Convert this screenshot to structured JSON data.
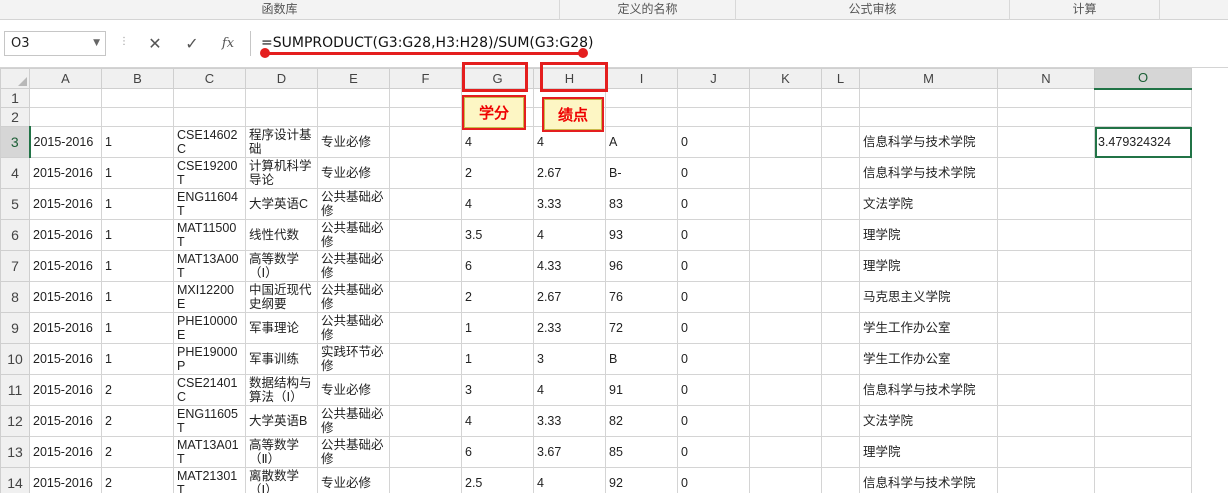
{
  "ribbon": {
    "groups": [
      "函数库",
      "定义的名称",
      "公式审核",
      "计算"
    ]
  },
  "formula_bar": {
    "name_box": "O3",
    "cancel_glyph": "✕",
    "enter_glyph": "✓",
    "fx_glyph": "fx",
    "formula": "=SUMPRODUCT(G3:G28,H3:H28)/SUM(G3:G28)"
  },
  "columns": [
    "A",
    "B",
    "C",
    "D",
    "E",
    "F",
    "G",
    "H",
    "I",
    "J",
    "K",
    "L",
    "M",
    "N",
    "O"
  ],
  "annotations": {
    "credit_label": "学分",
    "gpa_label": "绩点"
  },
  "rows": [
    {
      "num": "1",
      "cells": [
        "",
        "",
        "",
        "",
        "",
        "",
        "",
        "",
        "",
        "",
        "",
        "",
        "",
        "",
        ""
      ]
    },
    {
      "num": "2",
      "cells": [
        "",
        "",
        "",
        "",
        "",
        "",
        "",
        "",
        "",
        "",
        "",
        "",
        "",
        "",
        ""
      ]
    },
    {
      "num": "3",
      "cells": [
        "2015-2016",
        "1",
        "CSE14602C",
        "程序设计基础",
        "专业必修",
        "",
        "4",
        "4",
        "A",
        "0",
        "",
        "",
        "信息科学与技术学院",
        "",
        "3.479324324"
      ]
    },
    {
      "num": "4",
      "cells": [
        "2015-2016",
        "1",
        "CSE19200T",
        "计算机科学导论",
        "专业必修",
        "",
        "2",
        "2.67",
        "B-",
        "0",
        "",
        "",
        "信息科学与技术学院",
        "",
        ""
      ]
    },
    {
      "num": "5",
      "cells": [
        "2015-2016",
        "1",
        "ENG11604T",
        "大学英语C",
        "公共基础必修",
        "",
        "4",
        "3.33",
        "83",
        "0",
        "",
        "",
        "文法学院",
        "",
        ""
      ]
    },
    {
      "num": "6",
      "cells": [
        "2015-2016",
        "1",
        "MAT11500T",
        "线性代数",
        "公共基础必修",
        "",
        "3.5",
        "4",
        "93",
        "0",
        "",
        "",
        "理学院",
        "",
        ""
      ]
    },
    {
      "num": "7",
      "cells": [
        "2015-2016",
        "1",
        "MAT13A00T",
        "高等数学（Ⅰ）",
        "公共基础必修",
        "",
        "6",
        "4.33",
        "96",
        "0",
        "",
        "",
        "理学院",
        "",
        ""
      ]
    },
    {
      "num": "8",
      "cells": [
        "2015-2016",
        "1",
        "MXI12200E",
        "中国近现代史纲要",
        "公共基础必修",
        "",
        "2",
        "2.67",
        "76",
        "0",
        "",
        "",
        "马克思主义学院",
        "",
        ""
      ]
    },
    {
      "num": "9",
      "cells": [
        "2015-2016",
        "1",
        "PHE10000E",
        "军事理论",
        "公共基础必修",
        "",
        "1",
        "2.33",
        "72",
        "0",
        "",
        "",
        "学生工作办公室",
        "",
        ""
      ]
    },
    {
      "num": "10",
      "cells": [
        "2015-2016",
        "1",
        "PHE19000P",
        "军事训练",
        "实践环节必修",
        "",
        "1",
        "3",
        "B",
        "0",
        "",
        "",
        "学生工作办公室",
        "",
        ""
      ]
    },
    {
      "num": "11",
      "cells": [
        "2015-2016",
        "2",
        "CSE21401C",
        "数据结构与算法（Ⅰ）",
        "专业必修",
        "",
        "3",
        "4",
        "91",
        "0",
        "",
        "",
        "信息科学与技术学院",
        "",
        ""
      ]
    },
    {
      "num": "12",
      "cells": [
        "2015-2016",
        "2",
        "ENG11605T",
        "大学英语B",
        "公共基础必修",
        "",
        "4",
        "3.33",
        "82",
        "0",
        "",
        "",
        "文法学院",
        "",
        ""
      ]
    },
    {
      "num": "13",
      "cells": [
        "2015-2016",
        "2",
        "MAT13A01T",
        "高等数学（Ⅱ）",
        "公共基础必修",
        "",
        "6",
        "3.67",
        "85",
        "0",
        "",
        "",
        "理学院",
        "",
        ""
      ]
    },
    {
      "num": "14",
      "cells": [
        "2015-2016",
        "2",
        "MAT21301T",
        "离散数学（Ⅰ）",
        "专业必修",
        "",
        "2.5",
        "4",
        "92",
        "0",
        "",
        "",
        "信息科学与技术学院",
        "",
        ""
      ]
    }
  ]
}
